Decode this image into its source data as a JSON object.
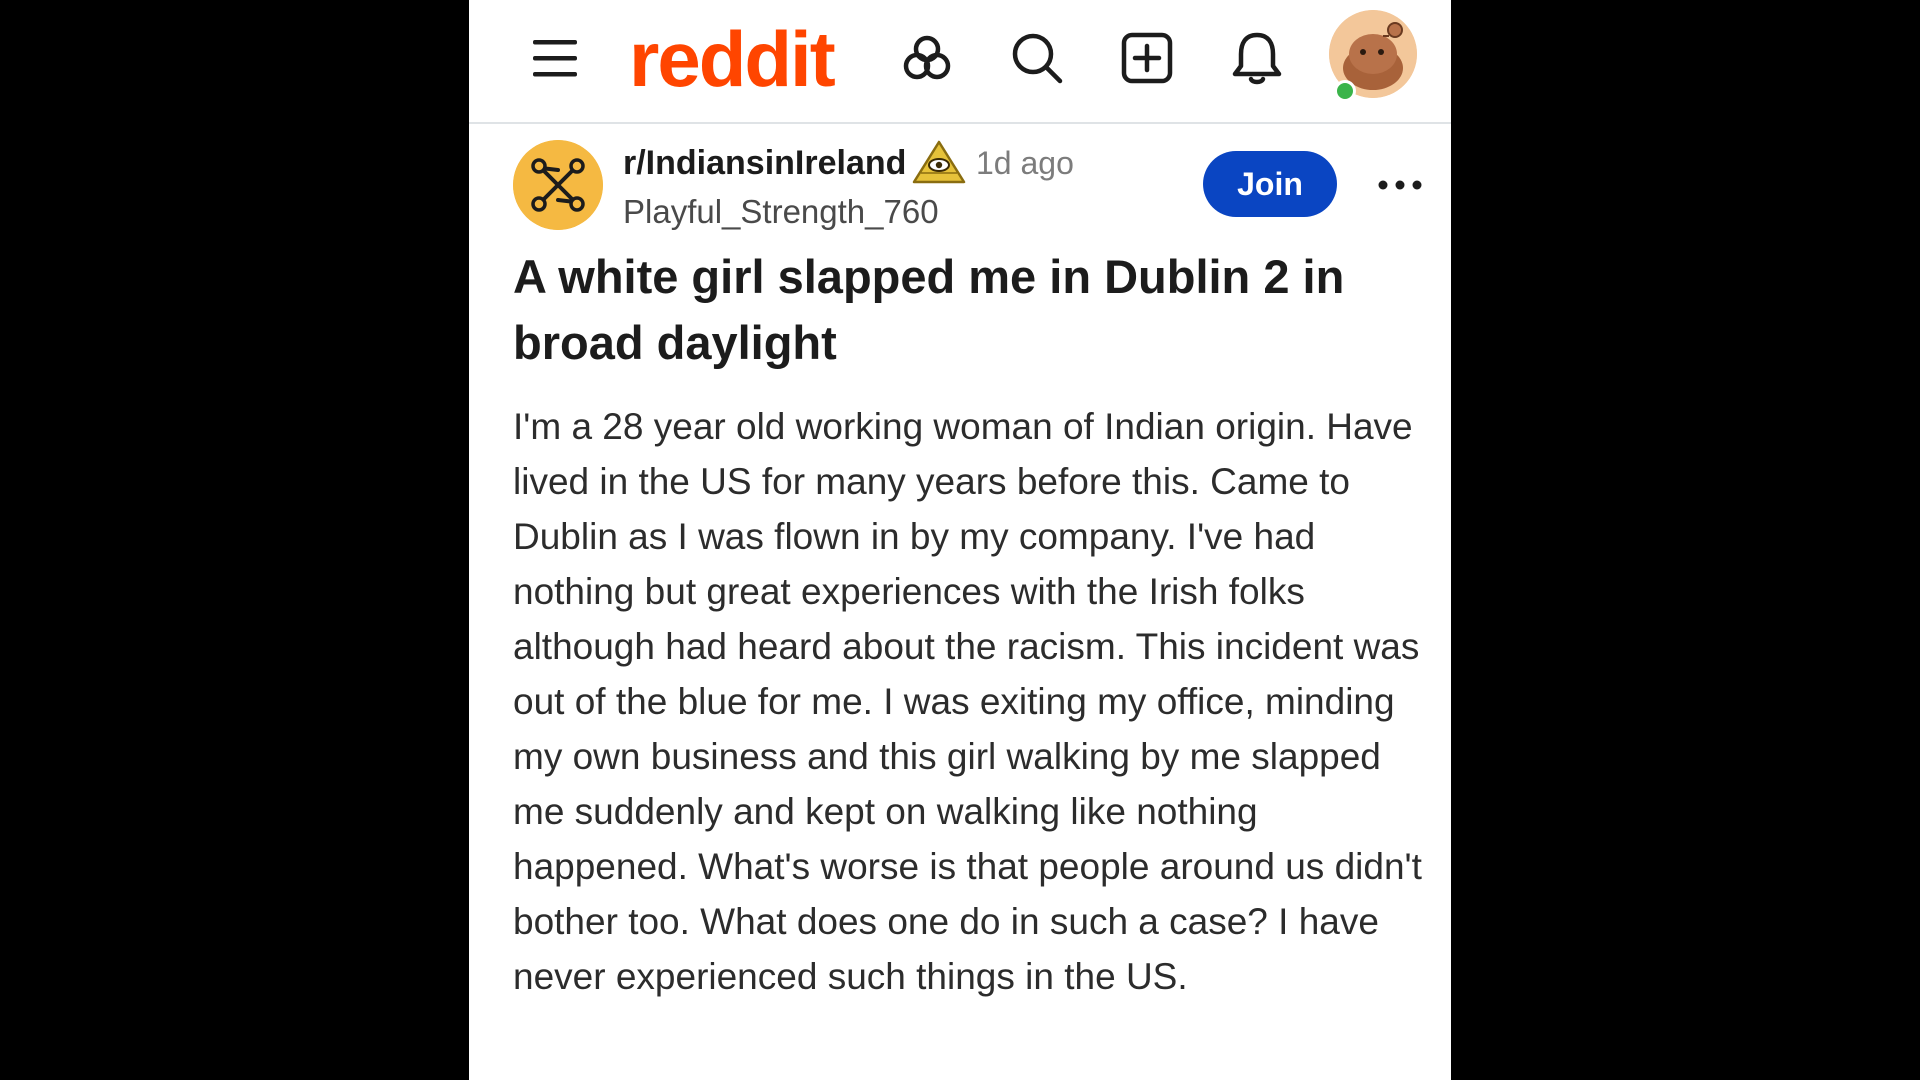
{
  "header": {
    "logo_text": "reddit",
    "icons": {
      "menu": "hamburger-menu-icon",
      "popular": "popular-icon",
      "search": "search-icon",
      "create": "create-post-icon",
      "notifications": "bell-icon",
      "avatar": "user-avatar",
      "status": "online-status-dot"
    }
  },
  "post": {
    "subreddit": "r/IndiansinIreland",
    "flair_icon": "pyramid-eye-icon",
    "time_ago": "1d ago",
    "author": "Playful_Strength_760",
    "join_label": "Join",
    "more_icon": "more-options-icon",
    "title": "A white girl slapped me in Dublin 2 in broad daylight",
    "body": "I'm a 28 year old working woman of Indian origin. Have lived in the US for many years before this. Came to Dublin as I was flown in by my company. I've had nothing but great experiences with the Irish folks although had heard about the racism. This incident was out of the blue for me. I was exiting my office, minding my own business and this girl walking by me slapped me suddenly and kept on walking like nothing happened. What's worse is that people around us didn't bother too. What does one do in such a case? I have never experienced such things in the US."
  },
  "colors": {
    "brand": "#ff4500",
    "join_button": "#0a45c2",
    "subreddit_icon_bg": "#f5b942",
    "online": "#3ab44a",
    "page_background": "#000000"
  }
}
